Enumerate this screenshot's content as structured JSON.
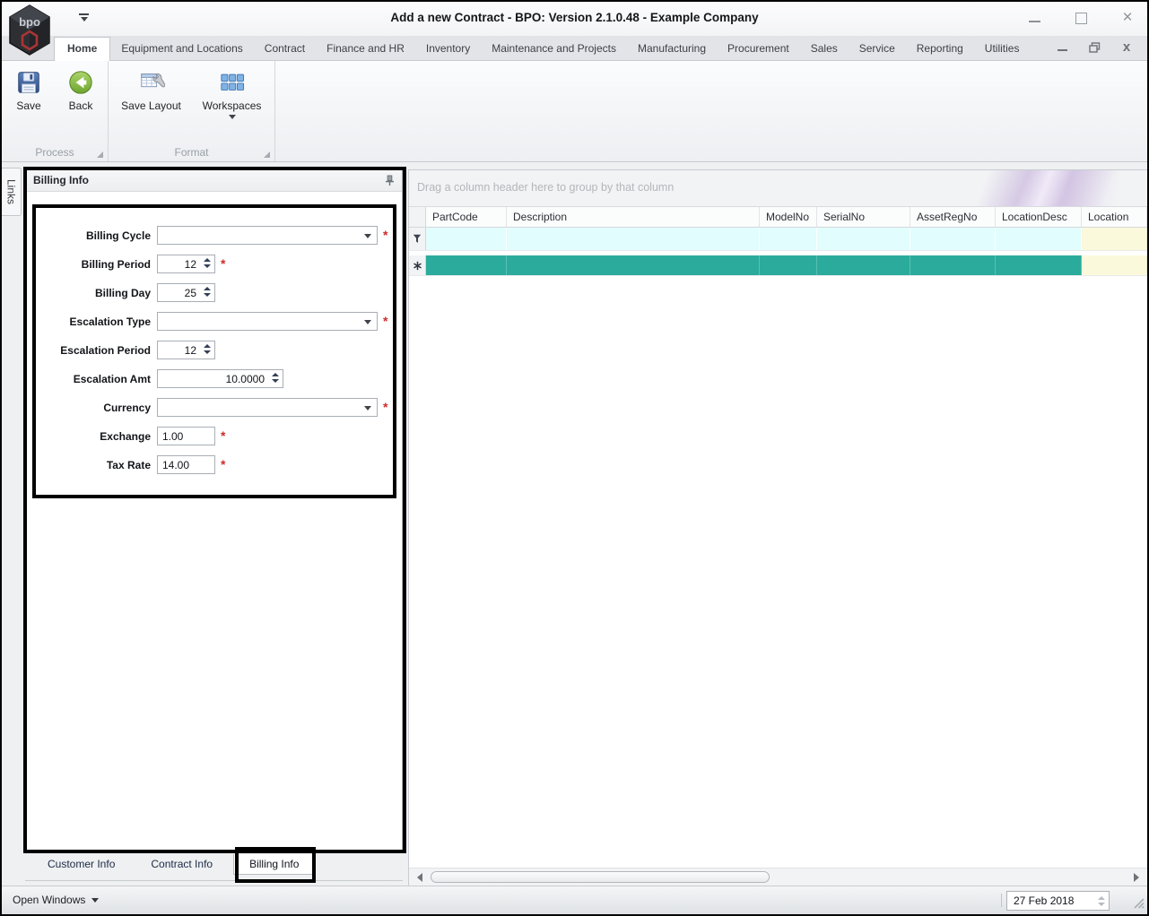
{
  "window": {
    "title": "Add a new Contract - BPO: Version 2.1.0.48 - Example Company",
    "logo_text": "bpo"
  },
  "ribbon": {
    "tabs": [
      "Home",
      "Equipment and Locations",
      "Contract",
      "Finance and HR",
      "Inventory",
      "Maintenance and Projects",
      "Manufacturing",
      "Procurement",
      "Sales",
      "Service",
      "Reporting",
      "Utilities"
    ],
    "active_tab": "Home",
    "groups": [
      {
        "caption": "Process",
        "buttons": [
          {
            "label": "Save",
            "icon": "save-floppy-icon"
          },
          {
            "label": "Back",
            "icon": "back-arrow-icon"
          }
        ]
      },
      {
        "caption": "Format",
        "buttons": [
          {
            "label": "Save Layout",
            "icon": "save-layout-icon"
          },
          {
            "label": "Workspaces",
            "icon": "workspaces-icon",
            "has_dropdown": true
          }
        ]
      }
    ]
  },
  "links_tab": {
    "label": "Links"
  },
  "billing_panel": {
    "title": "Billing Info",
    "required_marker": "*",
    "fields": [
      {
        "label": "Billing Cycle",
        "type": "dropdown",
        "value": "",
        "required": true
      },
      {
        "label": "Billing Period",
        "type": "spin",
        "value": "12",
        "required": true
      },
      {
        "label": "Billing Day",
        "type": "spin",
        "value": "25",
        "required": false
      },
      {
        "label": "Escalation Type",
        "type": "dropdown",
        "value": "",
        "required": true
      },
      {
        "label": "Escalation Period",
        "type": "spin",
        "value": "12",
        "required": false
      },
      {
        "label": "Escalation Amt",
        "type": "spin",
        "value": "10.0000",
        "required": false
      },
      {
        "label": "Currency",
        "type": "dropdown",
        "value": "",
        "required": true
      },
      {
        "label": "Exchange",
        "type": "text",
        "value": "1.00",
        "required": true
      },
      {
        "label": "Tax Rate",
        "type": "text",
        "value": "14.00",
        "required": true
      }
    ],
    "tabs": [
      {
        "label": "Customer Info",
        "active": false
      },
      {
        "label": "Contract Info",
        "active": false
      },
      {
        "label": "Billing Info",
        "active": true
      }
    ]
  },
  "grid": {
    "group_hint": "Drag a column header here to group by that column",
    "columns": [
      "PartCode",
      "Description",
      "ModelNo",
      "SerialNo",
      "AssetRegNo",
      "LocationDesc",
      "Location"
    ],
    "rows": [],
    "colors": {
      "new_row_teal": "#2bab9b",
      "filter_row_cyan": "#e2fdfd",
      "focused_column_yellow": "#fbf9dc"
    }
  },
  "statusbar": {
    "open_windows_label": "Open Windows",
    "date_value": "27 Feb 2018"
  }
}
